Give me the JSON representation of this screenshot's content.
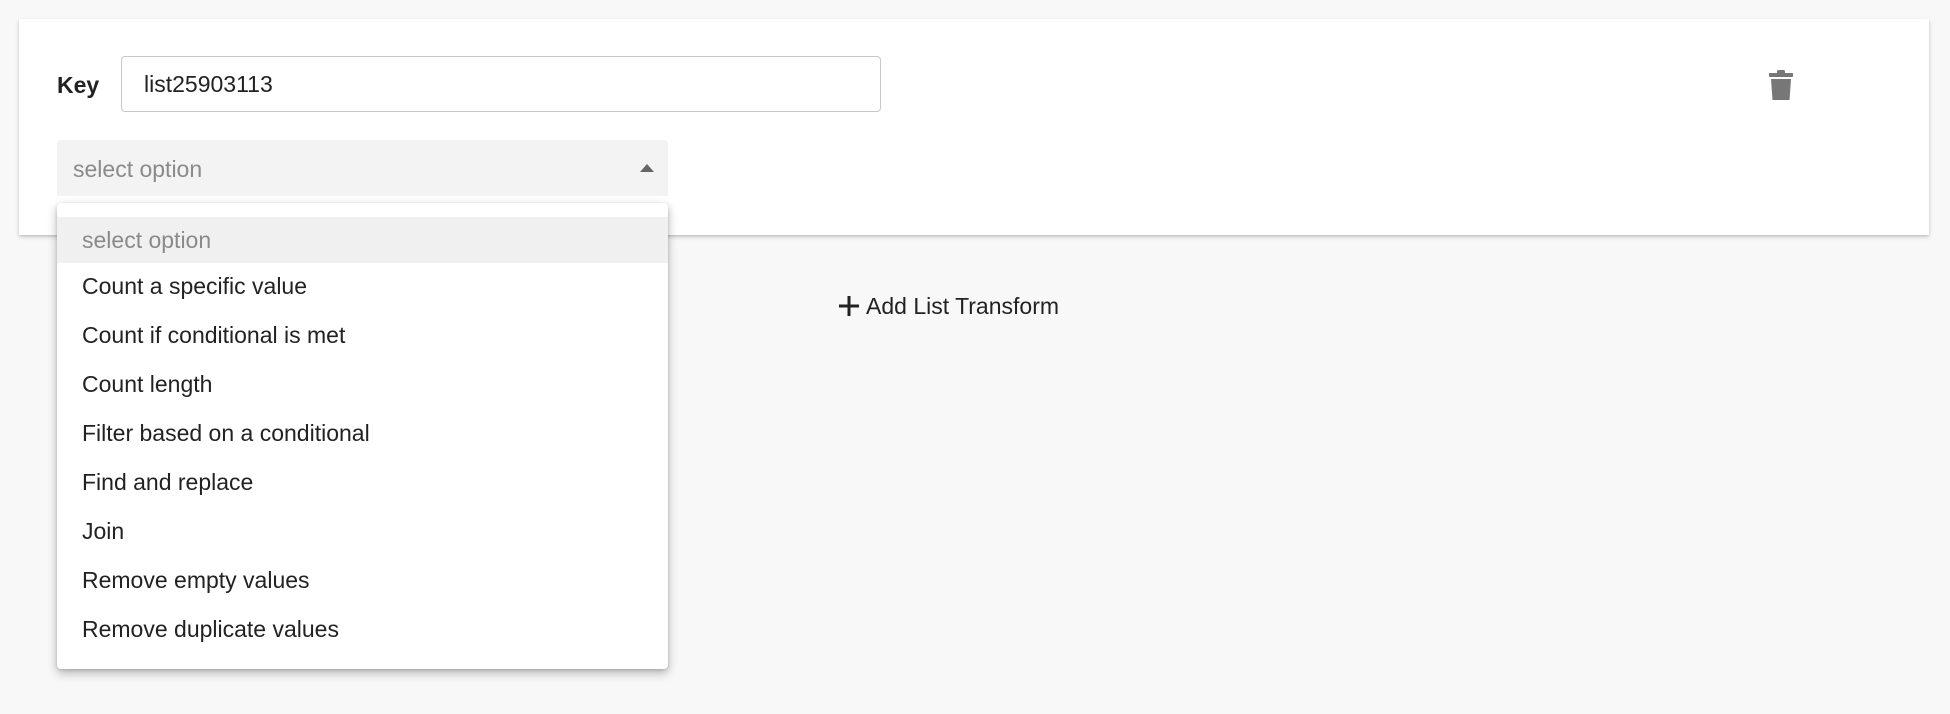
{
  "form": {
    "key_label": "Key",
    "key_value": "list25903113",
    "delete_icon": "trash-icon"
  },
  "select": {
    "current": "select option",
    "caret_icon": "caret-up-icon",
    "options": [
      "select option",
      "Count a specific value",
      "Count if conditional is met",
      "Count length",
      "Filter based on a conditional",
      "Find and replace",
      "Join",
      "Remove empty values",
      "Remove duplicate values"
    ]
  },
  "actions": {
    "add_transform_label": "Add List Transform",
    "add_icon": "plus-icon"
  },
  "colors": {
    "background": "#f8f8f8",
    "card": "#ffffff",
    "placeholder_text": "#8a8a8a",
    "icon": "#777777"
  }
}
